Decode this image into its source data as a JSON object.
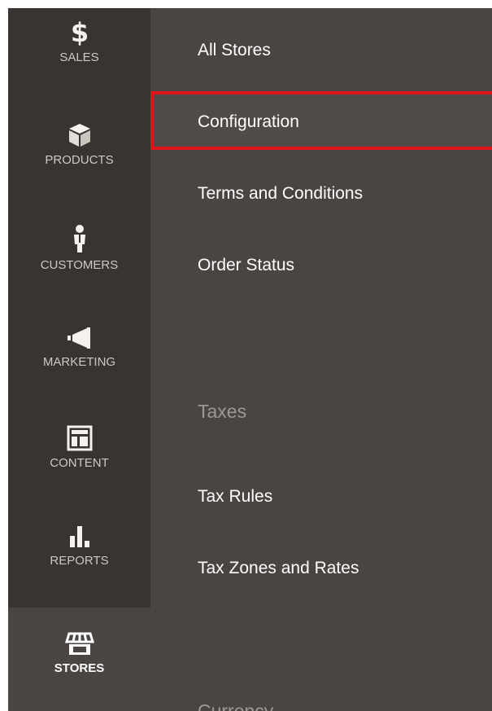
{
  "sidebar": {
    "items": [
      {
        "label": "SALES",
        "icon": "dollar-icon"
      },
      {
        "label": "PRODUCTS",
        "icon": "box-icon"
      },
      {
        "label": "CUSTOMERS",
        "icon": "person-icon"
      },
      {
        "label": "MARKETING",
        "icon": "megaphone-icon"
      },
      {
        "label": "CONTENT",
        "icon": "layout-icon"
      },
      {
        "label": "REPORTS",
        "icon": "bar-chart-icon"
      },
      {
        "label": "STORES",
        "icon": "storefront-icon",
        "active": true
      }
    ]
  },
  "submenu": {
    "links": [
      "All Stores",
      "Configuration",
      "Terms and Conditions",
      "Order Status"
    ],
    "highlighted": "Configuration",
    "taxes": {
      "title": "Taxes",
      "links": [
        "Tax Rules",
        "Tax Zones and Rates"
      ]
    },
    "currency": {
      "title": "Currency"
    }
  },
  "colors": {
    "sidebar_bg": "#393431",
    "panel_bg": "#4a4542",
    "highlight_border": "#e1141a",
    "section_title": "#9e9893"
  }
}
